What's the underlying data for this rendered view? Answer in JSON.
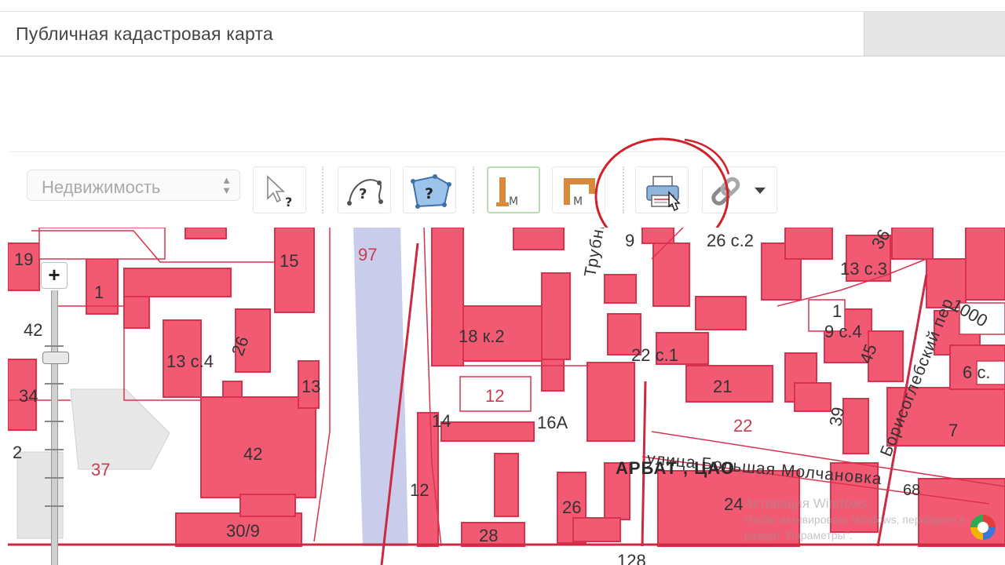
{
  "app": {
    "title": "Публичная кадастровая карта"
  },
  "toolbar": {
    "layer_select": {
      "value": "Недвижимость"
    },
    "tools": [
      {
        "name": "identify-tool",
        "icon": "cursor-question-icon"
      },
      {
        "name": "select-by-polyline",
        "icon": "curve-question-icon"
      },
      {
        "name": "select-by-polygon",
        "icon": "polygon-question-icon"
      },
      {
        "name": "measure-distance",
        "icon": "ruler-m-icon",
        "active": true
      },
      {
        "name": "measure-area",
        "icon": "area-m-icon"
      },
      {
        "name": "print",
        "icon": "printer-icon",
        "highlighted": true
      },
      {
        "name": "link",
        "icon": "chain-link-icon"
      }
    ],
    "highlight_color": "#d0202a"
  },
  "map": {
    "labels": {
      "b19": "19",
      "b15": "15",
      "b97": "97",
      "b1": "1",
      "b42a": "42",
      "b13s4": "13 с.4",
      "b26": "26",
      "b13": "13",
      "b34": "34",
      "b2": "2",
      "b37": "37",
      "b42": "42",
      "b30_9": "30/9",
      "b18k2": "18 к.2",
      "b12a": "12",
      "b14": "14",
      "b16a": "16А",
      "b12b": "12",
      "b26b": "26",
      "b28": "28",
      "b22s1": "22 с.1",
      "b21": "21",
      "b22": "22",
      "b24": "24",
      "b128": "128",
      "b26s2": "26 с.2",
      "b13s3": "13 с.3",
      "b9s4": "9 с.4",
      "b1000": "1000",
      "b6s": "6 с.",
      "b45": "45",
      "b39": "39",
      "b7": "7",
      "b68": "68",
      "b36": "36",
      "b1r": "1",
      "b9": "9"
    },
    "streets": {
      "molchanovka": "улица Большая Молчановка",
      "trubnikovsky": "Трубниковский",
      "borisoglebsky": "Борисоглебский пер"
    },
    "district": "АРБАТ , ЦАО",
    "colors": {
      "parcel_fill": "#f25a73",
      "parcel_stroke": "#d8324f",
      "boundary": "#cc2a42",
      "river_fill": "#c9cdeb"
    }
  },
  "watermark": {
    "line1": "Активация Windows",
    "line2": "Чтобы активировать Windows, перейдите в",
    "line3": "раздел \"Параметры\"."
  }
}
